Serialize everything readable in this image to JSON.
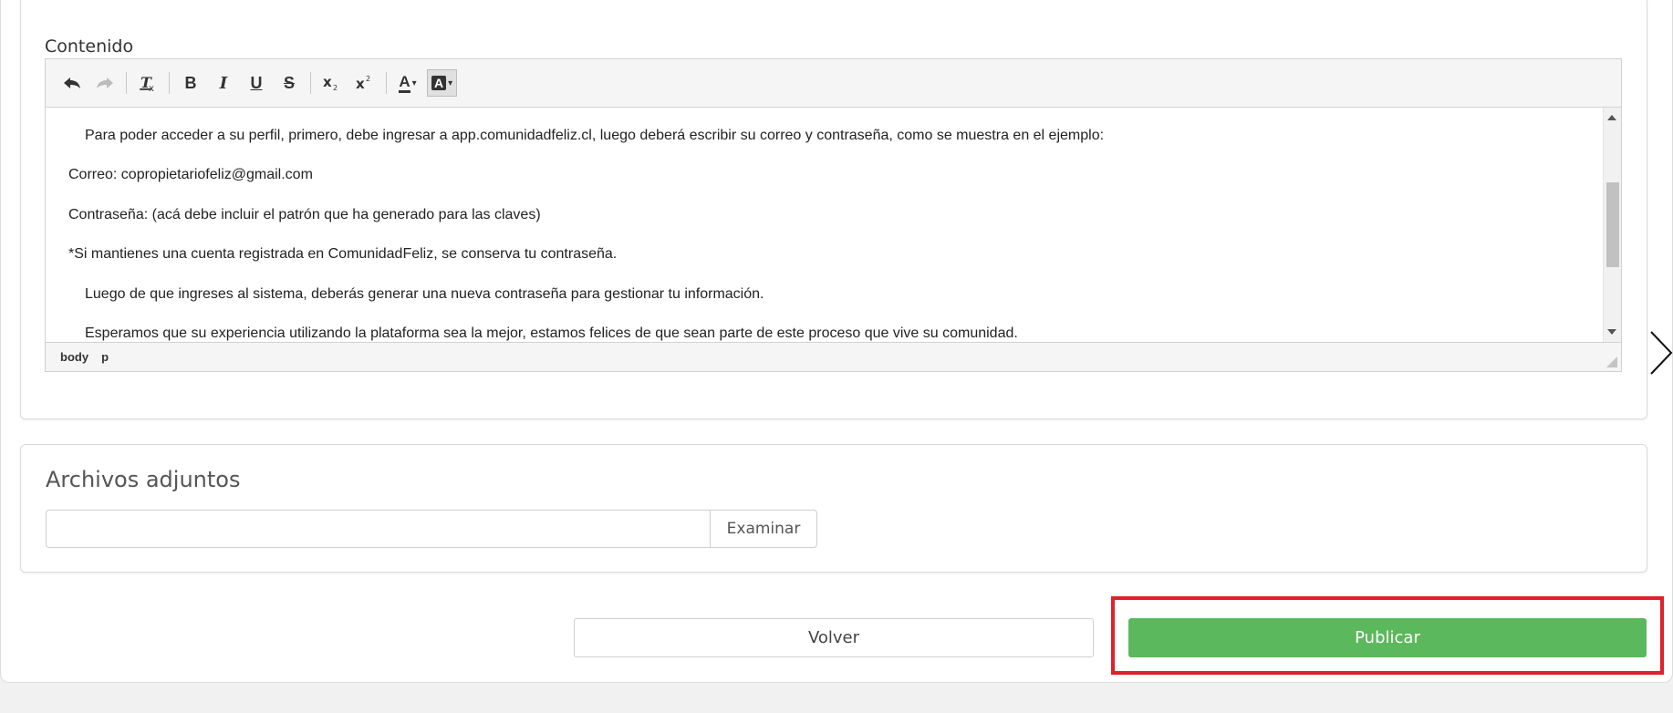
{
  "content_section": {
    "label": "Contenido"
  },
  "editor": {
    "toolbar": {
      "bold": "B",
      "italic": "I",
      "underline": "U",
      "strike": "S",
      "font_color": "A",
      "bg_color": "A"
    },
    "paragraphs": [
      "Para poder acceder a su perfil, primero, debe ingresar a app.comunidadfeliz.cl, luego deberá escribir su correo y contraseña, como se muestra en el ejemplo:",
      "Correo: copropietariofeliz@gmail.com",
      "Contraseña: (acá debe incluir el patrón que ha generado para las claves)",
      "*Si mantienes una cuenta registrada en ComunidadFeliz, se conserva tu contraseña.",
      "Luego de que ingreses al sistema, deberás generar una nueva contraseña para gestionar tu información.",
      "Esperamos que su experiencia utilizando la plataforma sea la mejor, estamos felices de que sean parte de este proceso que vive su comunidad."
    ],
    "status_path": [
      "body",
      "p"
    ]
  },
  "attachments": {
    "title": "Archivos adjuntos",
    "file_value": "",
    "browse_label": "Examinar"
  },
  "actions": {
    "back_label": "Volver",
    "publish_label": "Publicar",
    "publish_color": "#5cb85c",
    "highlight_color": "#e0202a"
  }
}
